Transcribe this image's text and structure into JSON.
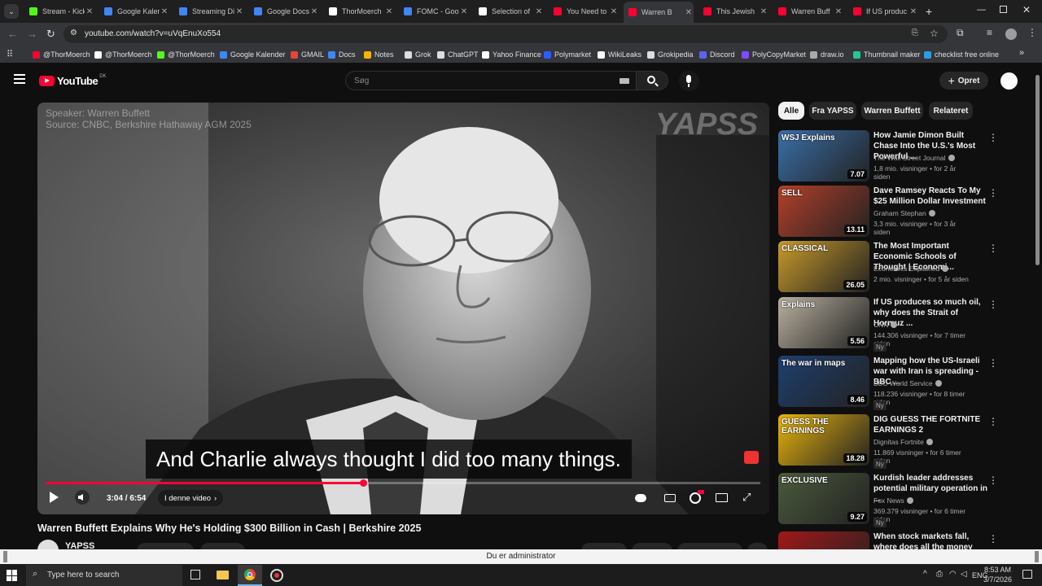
{
  "browser": {
    "tabs": [
      {
        "title": "Stream - Kick",
        "icon": "kick-icon",
        "color": "#53fc18"
      },
      {
        "title": "Google Kalender",
        "icon": "calendar-icon",
        "color": "#4285f4"
      },
      {
        "title": "Streaming Di",
        "icon": "docs-icon",
        "color": "#4285f4"
      },
      {
        "title": "Google Docs",
        "icon": "docs-icon",
        "color": "#4285f4"
      },
      {
        "title": "ThorMoerch",
        "icon": "x-icon",
        "color": "#ffffff"
      },
      {
        "title": "FOMC - Goo",
        "icon": "docs-icon",
        "color": "#4285f4"
      },
      {
        "title": "Selection of",
        "icon": "chatgpt-icon",
        "color": "#ffffff"
      },
      {
        "title": "You Need to",
        "icon": "youtube-icon",
        "color": "#ff0033"
      },
      {
        "title": "Warren B",
        "icon": "youtube-icon",
        "color": "#ff0033"
      },
      {
        "title": "This Jewish",
        "icon": "youtube-icon",
        "color": "#ff0033"
      },
      {
        "title": "Warren Buff",
        "icon": "youtube-icon",
        "color": "#ff0033"
      },
      {
        "title": "If US produc",
        "icon": "youtube-icon",
        "color": "#ff0033"
      }
    ],
    "url": "youtube.com/watch?v=uVqEnuXo554",
    "bookmarks": [
      {
        "label": "@ThorMoerch",
        "color": "#ff0033"
      },
      {
        "label": "@ThorMoerch",
        "color": "#ffffff"
      },
      {
        "label": "@ThorMoerch",
        "color": "#53fc18"
      },
      {
        "label": "Google Kalender",
        "color": "#4285f4"
      },
      {
        "label": "GMAIL",
        "color": "#ea4335"
      },
      {
        "label": "Docs",
        "color": "#4285f4"
      },
      {
        "label": "Notes",
        "color": "#f4b400"
      },
      {
        "label": "Grok",
        "color": "#dddddd"
      },
      {
        "label": "ChatGPT",
        "color": "#dddddd"
      },
      {
        "label": "Yahoo Finance",
        "color": "#ffffff"
      },
      {
        "label": "Polymarket",
        "color": "#2d5bff"
      },
      {
        "label": "WikiLeaks",
        "color": "#ffffff"
      },
      {
        "label": "Grokipedia",
        "color": "#dddddd"
      },
      {
        "label": "Discord",
        "color": "#5865f2"
      },
      {
        "label": "PolyCopyMarket",
        "color": "#7c4dff"
      },
      {
        "label": "draw.io",
        "color": "#aaaaaa"
      },
      {
        "label": "Thumbnail maker",
        "color": "#20c997"
      },
      {
        "label": "checklist free online",
        "color": "#2d9cdb"
      }
    ]
  },
  "youtube": {
    "logo_text": "YouTube",
    "region": "DK",
    "search_placeholder": "Søg",
    "create_label": "Opret",
    "chips": [
      "Alle",
      "Fra YAPSS",
      "Warren Buffett",
      "Relateret"
    ],
    "player": {
      "speaker_line": "Speaker: Warren Buffett",
      "source_line": "Source: CNBC, Berkshire Hathaway AGM 2025",
      "watermark": "YAPSS",
      "caption": "And Charlie always thought I did too many things.",
      "time": "3:04 / 6:54",
      "chapter": "I denne video",
      "progress": 0.444
    },
    "video_title": "Warren Buffett Explains Why He's Holding $300 Billion in Cash | Berkshire 2025",
    "channel_name": "YAPSS",
    "recommendations": [
      {
        "title": "How Jamie Dimon Built Chase Into the U.S.'s Most Powerful ...",
        "channel": "The Wall Street Journal",
        "meta": "1,8 mio. visninger • for 2 år siden",
        "duration": "7.07",
        "new": "",
        "thumb_color": "#3a6fa8",
        "thumb_text": "WSJ Explains"
      },
      {
        "title": "Dave Ramsey Reacts To My $25 Million Dollar Investment",
        "channel": "Graham Stephan",
        "meta": "3,3 mio. visninger • for 3 år siden",
        "duration": "13.11",
        "new": "",
        "thumb_color": "#b3402a",
        "thumb_text": "SELL"
      },
      {
        "title": "The Most Important Economic Schools of Thought | Economi...",
        "channel": "Economics Explained",
        "meta": "2 mio. visninger • for 5 år siden",
        "duration": "26.05",
        "new": "",
        "thumb_color": "#c79a2b",
        "thumb_text": "CLASSICAL"
      },
      {
        "title": "If US produces so much oil, why does the Strait of Hormuz ...",
        "channel": "CNN",
        "meta": "144.306 visninger • for 7 timer siden",
        "duration": "5.56",
        "new": "Ny",
        "thumb_color": "#b9b0a0",
        "thumb_text": "Explains"
      },
      {
        "title": "Mapping how the US-Israeli war with Iran is spreading - BBC ...",
        "channel": "BBC World Service",
        "meta": "118.236 visninger • for 8 timer siden",
        "duration": "8.46",
        "new": "Ny",
        "thumb_color": "#1f3f6e",
        "thumb_text": "The war in maps"
      },
      {
        "title": "DIG GUESS THE FORTNITE EARNINGS 2",
        "channel": "Dignitas Fortnite",
        "meta": "11.869 visninger • for 6 timer siden",
        "duration": "18.28",
        "new": "Ny",
        "thumb_color": "#e8b40c",
        "thumb_text": "GUESS THE EARNINGS"
      },
      {
        "title": "Kurdish leader addresses potential military operation in ...",
        "channel": "Fox News",
        "meta": "369.379 visninger • for 6 timer siden",
        "duration": "9.27",
        "new": "Ny",
        "thumb_color": "#4b5a3c",
        "thumb_text": "EXCLUSIVE"
      },
      {
        "title": "When stock markets fall, where does all the money that was lo...",
        "channel": "",
        "meta": "",
        "duration": "",
        "new": "",
        "thumb_color": "#a01818",
        "thumb_text": ""
      }
    ]
  },
  "windows": {
    "admin_text": "Du er administrator",
    "search_placeholder": "Type here to search",
    "language": "ENG",
    "time": "8:53 AM",
    "date": "3/7/2026"
  }
}
